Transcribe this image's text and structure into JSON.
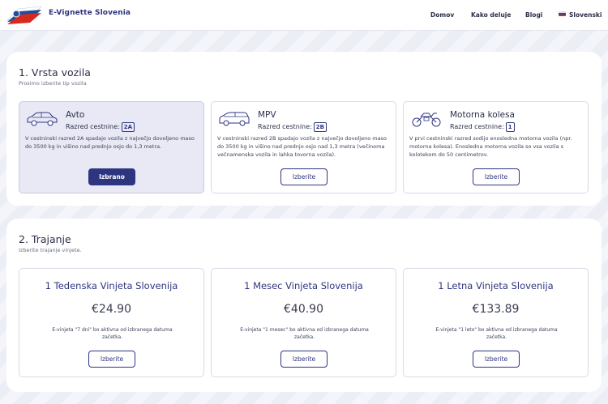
{
  "header": {
    "brand": "E-Vignette Slovenia",
    "nav": [
      "Domov",
      "Kako deluje",
      "Blogi",
      "Slovenski"
    ],
    "flag_colors": [
      "#ffffff",
      "#1c4fa0",
      "#d52b1e"
    ]
  },
  "vehicle_section": {
    "title": "1. Vrsta vozila",
    "subtitle": "Prosimo izberite tip vozila",
    "class_label": "Razred cestnine:",
    "cards": [
      {
        "name": "Avto",
        "icon": "car-icon",
        "class": "2A",
        "description": "V cestninski razred 2A spadajo vozila z največjo dovoljeno maso do 3500 kg in višino nad prednjo osjo do 1,3 metra.",
        "button": "Izbrano",
        "selected": true
      },
      {
        "name": "MPV",
        "icon": "van-icon",
        "class": "2B",
        "description": "V cestninski razred 2B spadajo vozila z največjo dovoljeno maso do 3500 kg in višino nad prednjo osjo nad 1,3 metra (večinoma večnamenska vozila in lahka tovorna vozila).",
        "button": "Izberite",
        "selected": false
      },
      {
        "name": "Motorna kolesa",
        "icon": "motorcycle-icon",
        "class": "1",
        "description": "V prvi cestninski razred sodijo enosledna motorna vozila (npr. motorna kolesa). Enosledna motorna vozila so vsa vozila s kolotekom do 50 centimetrov.",
        "button": "Izberite",
        "selected": false
      }
    ]
  },
  "duration_section": {
    "title": "2. Trajanje",
    "subtitle": "Izberite trajanje vinjete.",
    "cards": [
      {
        "title": "1 Tedenska Vinjeta Slovenija",
        "price": "€24.90",
        "note": "E-vinjeta \"7 dni\" bo aktivna od izbranega datuma začetka.",
        "button": "Izberite"
      },
      {
        "title": "1 Mesec Vinjeta Slovenija",
        "price": "€40.90",
        "note": "E-vinjeta \"1 mesec\" bo aktivna od izbranega datuma začetka.",
        "button": "Izberite"
      },
      {
        "title": "1 Letna Vinjeta Slovenija",
        "price": "€133.89",
        "note": "E-vinjeta \"1 leto\" bo aktivna od izbranega datuma začetka.",
        "button": "Izberite"
      }
    ]
  }
}
